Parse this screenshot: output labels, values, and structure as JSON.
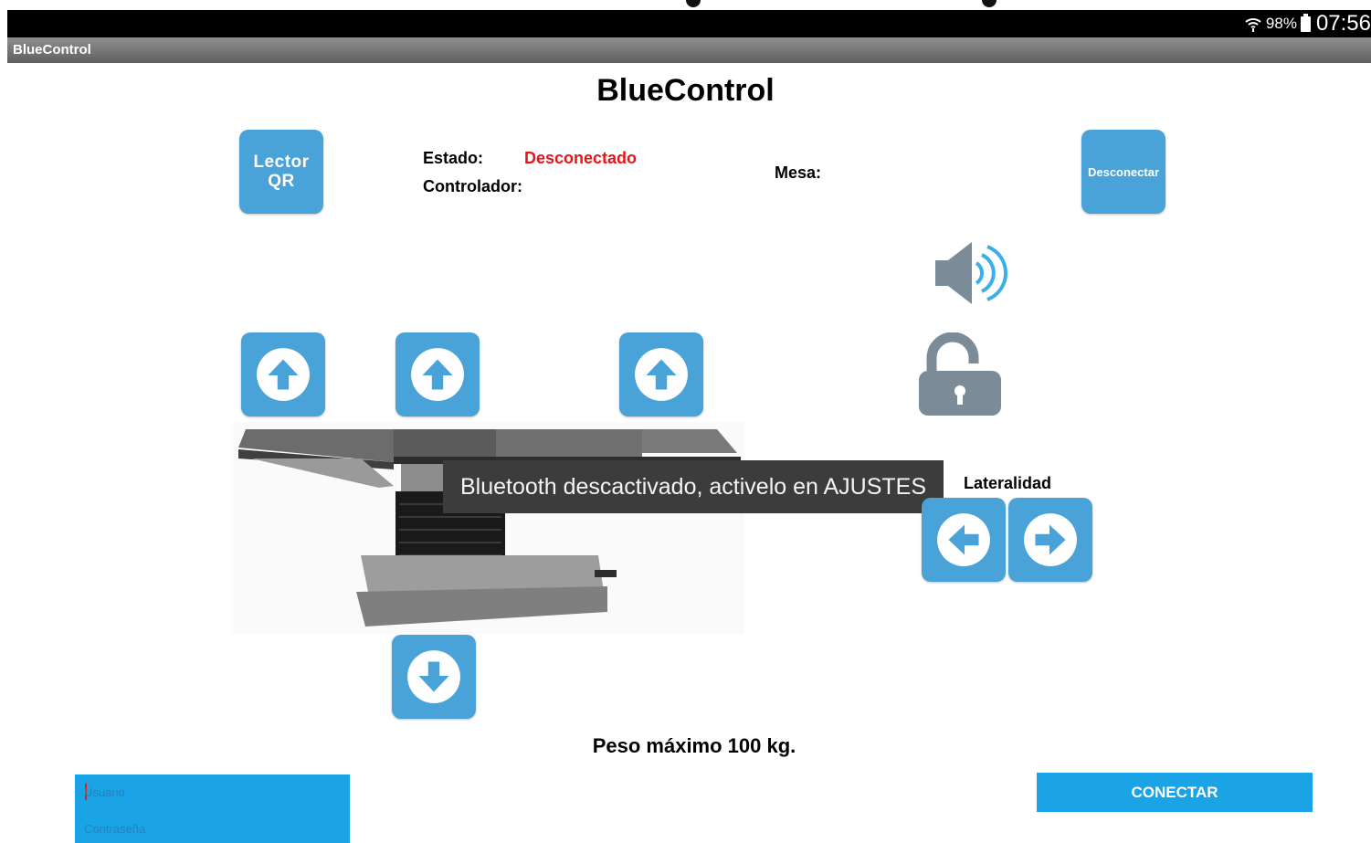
{
  "status_bar": {
    "battery_percent": "98%",
    "time": "07:56"
  },
  "app_bar": {
    "title": "BlueControl"
  },
  "header": {
    "title": "BlueControl"
  },
  "buttons": {
    "qr_line1": "Lector",
    "qr_line2": "QR",
    "disconnect": "Desconectar",
    "connect": "CONECTAR"
  },
  "info": {
    "estado_label": "Estado:",
    "estado_value": "Desconectado",
    "controlador_label": "Controlador:",
    "mesa_label": "Mesa:"
  },
  "lateralidad_label": "Lateralidad",
  "toast": "Bluetooth descactivado, activelo en AJUSTES",
  "weight_note": "Peso máximo 100 kg.",
  "login": {
    "user_placeholder": "Usuario",
    "password_placeholder": "Contraseña"
  },
  "colors": {
    "tile": "#4aa3d8",
    "accent": "#1aa4e6",
    "status_disconnected": "#e8141a",
    "icon_gray": "#7b8c98"
  },
  "icons": [
    "arrow-up-icon",
    "arrow-down-icon",
    "arrow-left-icon",
    "arrow-right-icon",
    "speaker-icon",
    "unlock-icon",
    "wifi-icon",
    "battery-icon"
  ]
}
